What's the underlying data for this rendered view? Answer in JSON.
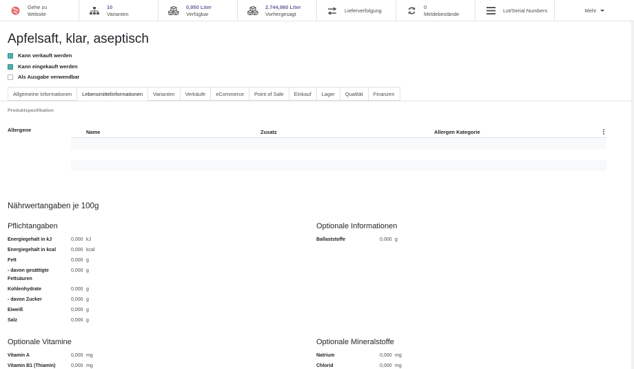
{
  "smart_buttons": [
    {
      "icon": "globe-icon",
      "line1": "Gehe zu",
      "line2": "Website",
      "color": "#e46f6f"
    },
    {
      "icon": "sitemap-icon",
      "line1": "10",
      "line2": "Varianten"
    },
    {
      "icon": "cubes-icon",
      "line1": "0,950 Liter",
      "line2": "Verfügbar"
    },
    {
      "icon": "cubes-icon",
      "line1": "2.744,980 Liter",
      "line2": "Vorhergesagt"
    },
    {
      "icon": "exchange-icon",
      "line1": "Lieferverfolgung",
      "line2": ""
    },
    {
      "icon": "refresh-icon",
      "line1": "0",
      "line2": "Meldebestände"
    },
    {
      "icon": "bars-icon",
      "line1": "Lot/Serial Numbers",
      "line2": ""
    }
  ],
  "more_label": "Mehr",
  "product": {
    "name": "Apfelsaft, klar, aseptisch",
    "checkboxes": [
      {
        "label": "Kann verkauft werden",
        "checked": true
      },
      {
        "label": "Kann eingekauft werden",
        "checked": true
      },
      {
        "label": "Als Ausgabe verwendbar",
        "checked": false
      }
    ]
  },
  "tabs": [
    "Allgemeine Informationen",
    "Lebensmittelinformationen",
    "Varianten",
    "Verkäufe",
    "eCommerce",
    "Point of Sale",
    "Einkauf",
    "Lager",
    "Qualität",
    "Finanzen"
  ],
  "active_tab": "Lebensmittelinformationen",
  "spec": {
    "section_label": "Produktspezifikation",
    "allergene_label": "Allergene",
    "columns": [
      "Name",
      "Zusatz",
      "Allergen Kategorie"
    ]
  },
  "nutrition": {
    "title": "Nährwertangaben je 100g",
    "mandatory_title": "Pflichtangaben",
    "mandatory": [
      {
        "label": "Energiegehalt in kJ",
        "value": "0,000",
        "unit": "kJ"
      },
      {
        "label": "Energiegehalt in kcal",
        "value": "0,000",
        "unit": "kcal"
      },
      {
        "label": "Fett",
        "value": "0,000",
        "unit": "g"
      },
      {
        "label": "- davon gesättigte",
        "label2": "Fettsäuren",
        "value": "0,000",
        "unit": "g"
      },
      {
        "label": "Kohlenhydrate",
        "value": "0,000",
        "unit": "g"
      },
      {
        "label": "- davon Zucker",
        "value": "0,000",
        "unit": "g"
      },
      {
        "label": "Eiweiß",
        "value": "0,000",
        "unit": "g"
      },
      {
        "label": "Salz",
        "value": "0,000",
        "unit": "g"
      }
    ],
    "optional_title": "Optionale Informationen",
    "optional": [
      {
        "label": "Ballaststoffe",
        "value": "0,000",
        "unit": "g"
      }
    ]
  },
  "vitamins": {
    "title": "Optionale Vitamine",
    "items": [
      {
        "label": "Vitamin A",
        "value": "0,000",
        "unit": "mg"
      },
      {
        "label": "Vitamin B1 (Thiamin)",
        "value": "0,000",
        "unit": "mg"
      }
    ]
  },
  "minerals": {
    "title": "Optionale Mineralstoffe",
    "items": [
      {
        "label": "Natrium",
        "value": "0,000",
        "unit": "mg"
      },
      {
        "label": "Chlorid",
        "value": "0,000",
        "unit": "mg"
      }
    ]
  }
}
